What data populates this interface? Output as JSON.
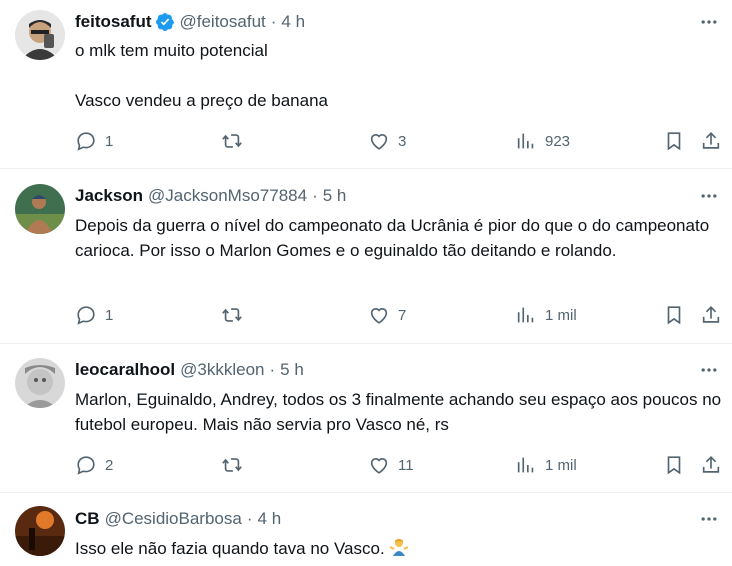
{
  "tweets": [
    {
      "name": "feitosafut",
      "verified": true,
      "handle": "@feitosafut",
      "separator": "·",
      "time": "4 h",
      "paragraphs": [
        "o mlk tem muito potencial",
        "Vasco vendeu a preço de banana"
      ],
      "replies": "1",
      "retweets": "",
      "likes": "3",
      "views": "923",
      "avatar_colors": [
        "#e6e6e6",
        "#3a3a3a"
      ]
    },
    {
      "name": "Jackson",
      "verified": false,
      "handle": "@JacksonMso77884",
      "separator": "·",
      "time": "5 h",
      "paragraphs": [
        "Depois da guerra o nível do campeonato da Ucrânia é pior do que o do campeonato carioca. Por isso o Marlon Gomes e o eguinaldo tão deitando e rolando."
      ],
      "replies": "1",
      "retweets": "",
      "likes": "7",
      "views": "1 mil",
      "avatar_colors": [
        "#3f6f4f",
        "#b07a55"
      ]
    },
    {
      "name": "leocaralhool",
      "verified": false,
      "handle": "@3kkkleon",
      "separator": "·",
      "time": "5 h",
      "paragraphs": [
        "Marlon, Eguinaldo, Andrey, todos os 3 finalmente achando seu espaço aos poucos no futebol europeu. Mais não servia pro Vasco né, rs"
      ],
      "replies": "2",
      "retweets": "",
      "likes": "11",
      "views": "1 mil",
      "avatar_colors": [
        "#d8d8d8",
        "#8a8a8a"
      ]
    },
    {
      "name": "CB",
      "verified": false,
      "handle": "@CesidioBarbosa",
      "separator": "·",
      "time": "4 h",
      "paragraphs": [
        "Isso ele não fazia quando tava no Vasco."
      ],
      "emoji": "man-shrugging",
      "avatar_colors": [
        "#5a2a10",
        "#e07a2a"
      ]
    }
  ],
  "colors": {
    "text": "#0f1419",
    "secondary": "#536471",
    "verified": "#1d9bf0",
    "divider": "#eff3f4"
  }
}
